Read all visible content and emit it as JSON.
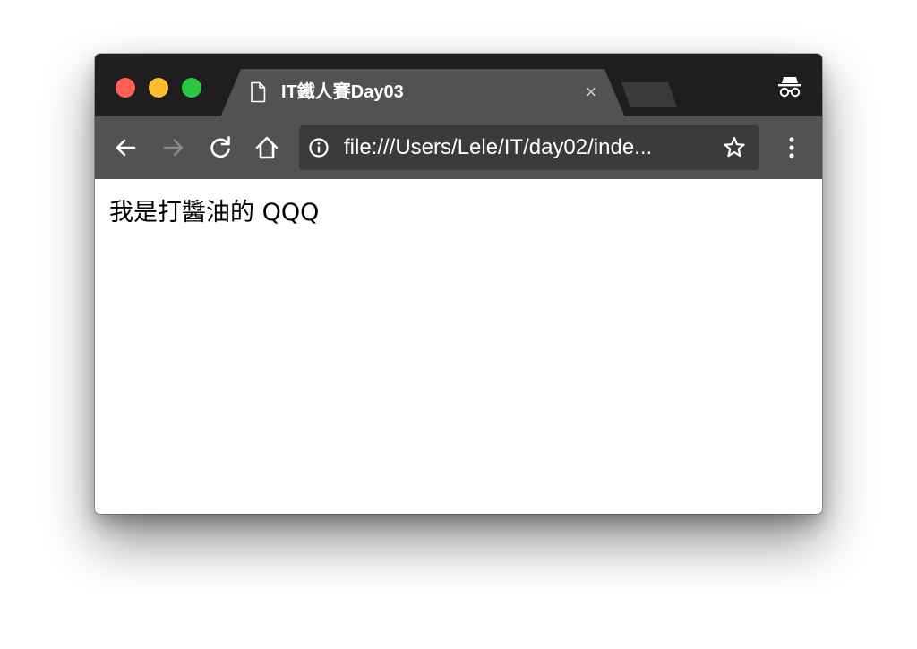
{
  "window": {
    "traffic_lights": {
      "close_color": "#ff5f57",
      "minimize_color": "#febc2e",
      "maximize_color": "#28c840"
    }
  },
  "tab": {
    "title": "IT鐵人賽Day03",
    "close_symbol": "×",
    "icon": "page-icon"
  },
  "toolbar": {
    "back_icon": "arrow-left-icon",
    "forward_icon": "arrow-right-icon",
    "reload_icon": "reload-icon",
    "home_icon": "home-icon",
    "url": "file:///Users/Lele/IT/day02/inde...",
    "site_info_icon": "info-icon",
    "bookmark_icon": "star-icon",
    "menu_icon": "kebab-menu-icon"
  },
  "incognito_icon": "incognito-icon",
  "page": {
    "body_text": "我是打醬油的 QQQ"
  },
  "colors": {
    "titlebar": "#1e1e1f",
    "tab": "#525254",
    "toolbar": "#525254",
    "omnibox": "#3b3b3d"
  }
}
